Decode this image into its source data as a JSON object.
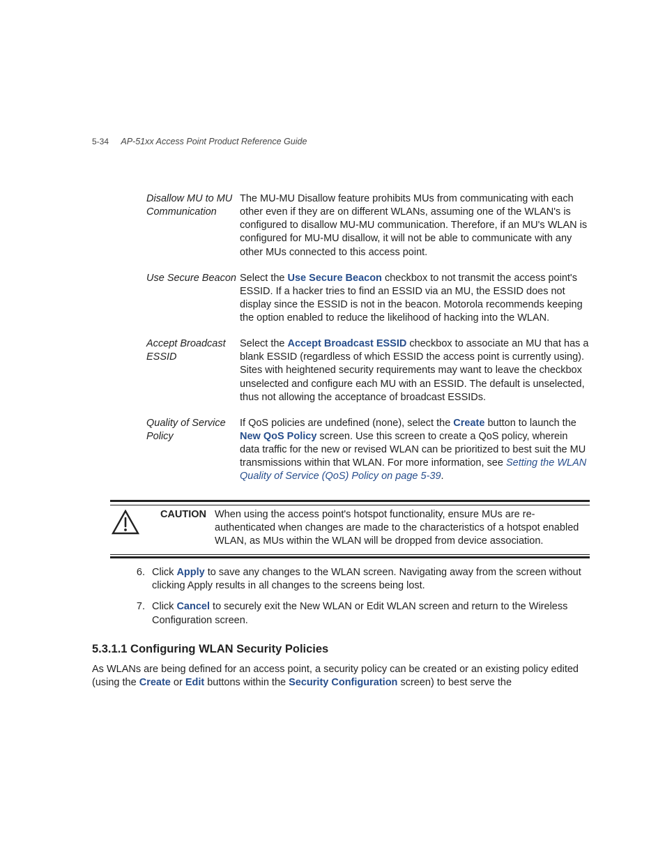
{
  "header": {
    "page_number": "5-34",
    "guide_title": "AP-51xx Access Point Product Reference Guide"
  },
  "definitions": [
    {
      "term": "Disallow MU to MU Communication",
      "desc": "The MU-MU Disallow feature prohibits MUs from communicating with each other even if they are on different WLANs, assuming one of the WLAN's is configured to disallow MU-MU communication. Therefore, if an MU's WLAN is configured for MU-MU disallow, it will not be able to communicate with any other MUs connected to this access point."
    },
    {
      "term": "Use Secure Beacon",
      "desc_pre": "Select the ",
      "desc_ui": "Use Secure Beacon",
      "desc_post": " checkbox to not transmit the access point's ESSID. If a hacker tries to find an ESSID via an MU, the ESSID does not display since the ESSID is not in the beacon. Motorola recommends keeping the option enabled to reduce the likelihood of hacking into the WLAN."
    },
    {
      "term": "Accept Broadcast ESSID",
      "desc_pre": "Select the ",
      "desc_ui": "Accept Broadcast ESSID",
      "desc_post": " checkbox to associate an MU that has a blank ESSID (regardless of which ESSID the access point is currently using). Sites with heightened security requirements may want to leave the checkbox unselected and configure each MU with an ESSID. The default is unselected, thus not allowing the acceptance of broadcast ESSIDs."
    },
    {
      "term": "Quality of Service Policy",
      "qos_pre1": "If QoS policies are undefined (none), select the ",
      "qos_ui1": "Create",
      "qos_mid": " button to launch the ",
      "qos_ui2": "New QoS Policy",
      "qos_post1": " screen. Use this screen to create a QoS policy, wherein data traffic for the new or revised WLAN can be prioritized to best suit the MU transmissions within that WLAN. For more information, see ",
      "qos_link": "Setting the WLAN Quality of Service (QoS) Policy on page 5-39",
      "qos_end": "."
    }
  ],
  "caution": {
    "label": "CAUTION",
    "text": "When using the access point's hotspot functionality, ensure MUs are re-authenticated when changes are made to the characteristics of a hotspot enabled WLAN, as MUs within the WLAN will be dropped from device association."
  },
  "steps": [
    {
      "num": "6.",
      "pre": "Click ",
      "ui": "Apply",
      "post": " to save any changes to the WLAN screen. Navigating away from the screen without clicking Apply results in all changes to the screens being lost."
    },
    {
      "num": "7.",
      "pre": "Click ",
      "ui": "Cancel",
      "post": " to securely exit the New WLAN or Edit WLAN screen and return to the Wireless Configuration screen."
    }
  ],
  "heading": "5.3.1.1  Configuring WLAN Security Policies",
  "paragraph": {
    "pre": "As WLANs are being defined for an access point, a security policy can be created or an existing policy edited (using the ",
    "ui1": "Create",
    "mid1": " or ",
    "ui2": "Edit",
    "mid2": " buttons within the ",
    "ui3": "Security Configuration",
    "post": " screen) to best serve the"
  }
}
